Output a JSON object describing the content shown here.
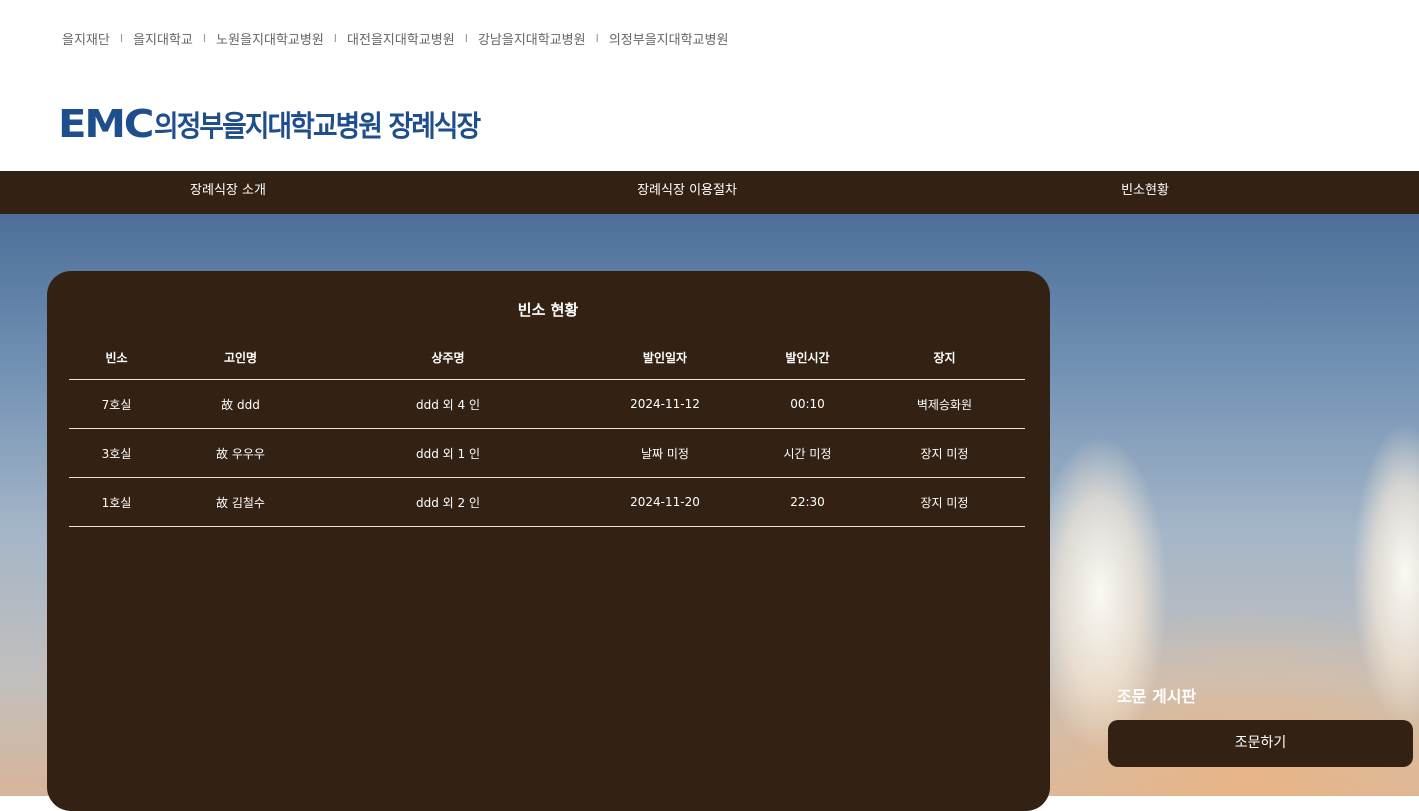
{
  "network_links": [
    "을지재단",
    "을지대학교",
    "노원을지대학교병원",
    "대전을지대학교병원",
    "강남을지대학교병원",
    "의정부을지대학교병원"
  ],
  "network_separator": "I",
  "logo": {
    "mark": "EMC",
    "text": "의정부을지대학교병원 장례식장"
  },
  "nav": {
    "items": [
      "장례식장 소개",
      "장례식장 이용절차",
      "빈소현황"
    ]
  },
  "status": {
    "title": "빈소 현황",
    "columns": [
      "빈소",
      "고인명",
      "상주명",
      "발인일자",
      "발인시간",
      "장지"
    ],
    "rows": [
      [
        "7호실",
        "故 ddd",
        "ddd 외 4 인",
        "2024-11-12",
        "00:10",
        "벽제승화원"
      ],
      [
        "3호실",
        "故 우우우",
        "ddd 외 1 인",
        "날짜 미정",
        "시간 미정",
        "장지 미정"
      ],
      [
        "1호실",
        "故 김철수",
        "ddd 외 2 인",
        "2024-11-20",
        "22:30",
        "장지 미정"
      ]
    ]
  },
  "board": {
    "title": "조문 게시판",
    "button_label": "조문하기"
  },
  "colors": {
    "brown": "#332214",
    "logo_blue": "#1f4e8c"
  }
}
